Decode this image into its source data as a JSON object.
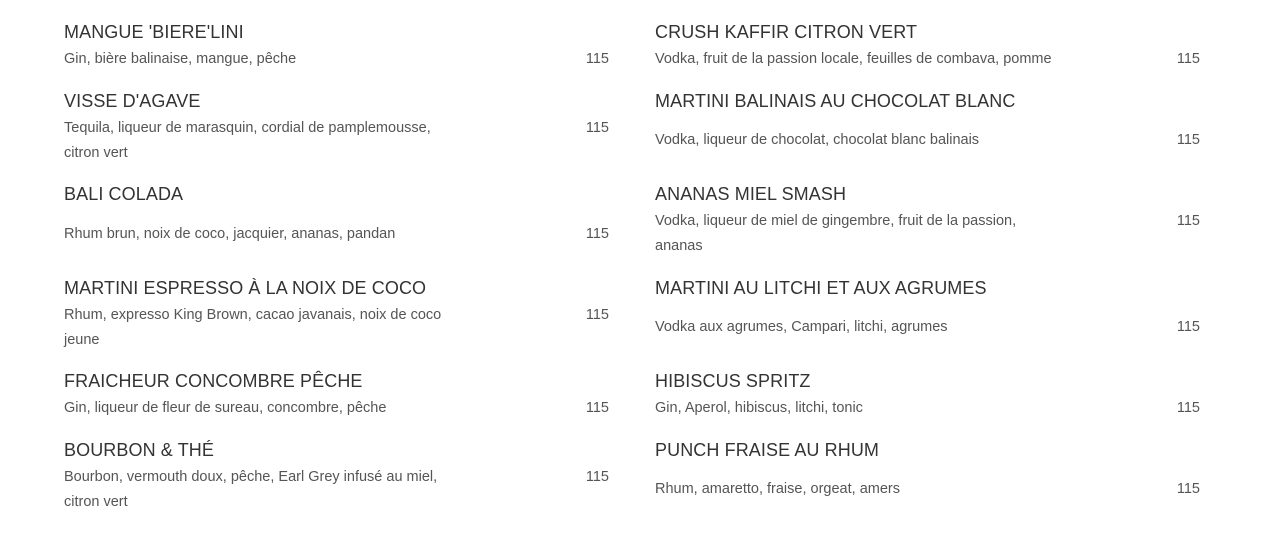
{
  "menu": {
    "left": [
      {
        "name": "MANGUE 'BIERE'LINI",
        "desc": "Gin, bière balinaise, mangue, pêche",
        "price": "115"
      },
      {
        "name": "VISSE D'AGAVE",
        "desc": "Tequila, liqueur de marasquin, cordial de pamplemousse, citron vert",
        "price": "115"
      },
      {
        "name": "BALI COLADA",
        "desc": "Rhum brun, noix de coco, jacquier, ananas, pandan",
        "price": "115"
      },
      {
        "name": "MARTINI ESPRESSO À LA NOIX DE COCO",
        "desc": "Rhum, expresso King Brown, cacao javanais, noix de coco jeune",
        "price": "115"
      },
      {
        "name": "FRAICHEUR CONCOMBRE PÊCHE",
        "desc": "Gin, liqueur de fleur de sureau, concombre, pêche",
        "price": "115"
      },
      {
        "name": "BOURBON & THÉ",
        "desc": "Bourbon, vermouth doux, pêche, Earl Grey infusé au miel, citron vert",
        "price": "115"
      }
    ],
    "right": [
      {
        "name": "CRUSH KAFFIR CITRON VERT",
        "desc": "Vodka, fruit de la passion locale, feuilles de combava, pomme",
        "price": "115"
      },
      {
        "name": "MARTINI BALINAIS AU CHOCOLAT BLANC",
        "desc": "Vodka, liqueur de chocolat, chocolat blanc balinais",
        "price": "115"
      },
      {
        "name": "ANANAS MIEL SMASH",
        "desc": "Vodka, liqueur de miel de gingembre, fruit de la passion, ananas",
        "price": "115"
      },
      {
        "name": "MARTINI AU LITCHI ET AUX AGRUMES",
        "desc": "Vodka aux agrumes, Campari, litchi, agrumes",
        "price": "115"
      },
      {
        "name": "HIBISCUS SPRITZ",
        "desc": "Gin, Aperol, hibiscus, litchi, tonic",
        "price": "115"
      },
      {
        "name": "PUNCH FRAISE AU RHUM",
        "desc": "Rhum, amaretto, fraise, orgeat, amers",
        "price": "115"
      }
    ]
  }
}
